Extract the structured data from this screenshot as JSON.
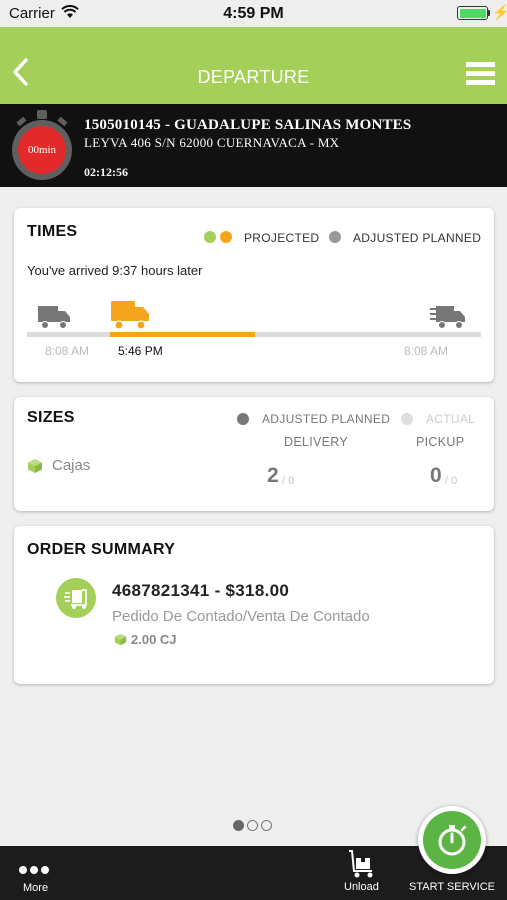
{
  "status_bar": {
    "carrier": "Carrier",
    "time": "4:59 PM"
  },
  "nav": {
    "title": "DEPARTURE",
    "back_icon": "chevron-left-icon",
    "menu_icon": "hamburger-menu-icon"
  },
  "trip": {
    "timer": "00min",
    "line1": "1505010145 - GUADALUPE SALINAS MONTES",
    "line2": "LEYVA 406 S/N 62000 CUERNAVACA - MX",
    "elapsed": "02:12:56",
    "colors": {
      "timer_red": "#e4292a",
      "band": "#111111"
    }
  },
  "times": {
    "title": "TIMES",
    "legend_projected": "PROJECTED",
    "legend_adjusted": "ADJUSTED PLANNED",
    "arrived_text": "You've arrived 9:37 hours later",
    "start_time": "8:08 AM",
    "current_time": "5:46 PM",
    "end_time": "8:08 AM",
    "progress_color": "#f5a51c",
    "projected_colors": [
      "#a4d05a",
      "#f5a51c"
    ]
  },
  "sizes": {
    "title": "SIZES",
    "legend_adjusted": "ADJUSTED PLANNED",
    "legend_actual": "ACTUAL",
    "delivery_label": "DELIVERY",
    "pickup_label": "PICKUP",
    "item_label": "Cajas",
    "delivery_value": "2",
    "delivery_sep": "/ 0",
    "pickup_value": "0",
    "pickup_sep": "/ 0"
  },
  "order_summary": {
    "title": "ORDER SUMMARY",
    "order_line": "4687821341 - $318.00",
    "description": "Pedido De Contado/Venta De Contado",
    "quantity": "2.00 CJ"
  },
  "pager": {
    "pages": 3,
    "active": 0
  },
  "bottom_bar": {
    "more_label": "More",
    "unload_label": "Unload",
    "start_label": "START SERVICE",
    "accent": "#5cb444"
  },
  "theme": {
    "primary": "#a4d05a"
  }
}
